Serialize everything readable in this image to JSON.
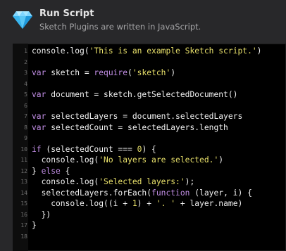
{
  "header": {
    "title": "Run Script",
    "subtitle": "Sketch Plugins are written in JavaScript.",
    "icon": "sketch-diamond-icon"
  },
  "editor": {
    "line_numbers": [
      "1",
      "2",
      "3",
      "4",
      "5",
      "6",
      "7",
      "8",
      "9",
      "10",
      "11",
      "12",
      "13",
      "14",
      "15",
      "16",
      "17",
      "18"
    ],
    "lines": [
      [
        {
          "t": "console.log(",
          "c": "fn"
        },
        {
          "t": "'This is an example Sketch script.'",
          "c": "str"
        },
        {
          "t": ")",
          "c": "fn"
        }
      ],
      [],
      [
        {
          "t": "var",
          "c": "kw"
        },
        {
          "t": " sketch = ",
          "c": "fn"
        },
        {
          "t": "require",
          "c": "kw"
        },
        {
          "t": "(",
          "c": "fn"
        },
        {
          "t": "'sketch'",
          "c": "str"
        },
        {
          "t": ")",
          "c": "fn"
        }
      ],
      [],
      [
        {
          "t": "var",
          "c": "kw"
        },
        {
          "t": " document = sketch.getSelectedDocument()",
          "c": "fn"
        }
      ],
      [],
      [
        {
          "t": "var",
          "c": "kw"
        },
        {
          "t": " selectedLayers = document.selectedLayers",
          "c": "fn"
        }
      ],
      [
        {
          "t": "var",
          "c": "kw"
        },
        {
          "t": " selectedCount = selectedLayers.length",
          "c": "fn"
        }
      ],
      [],
      [
        {
          "t": "if",
          "c": "kw"
        },
        {
          "t": " (selectedCount === ",
          "c": "fn"
        },
        {
          "t": "0",
          "c": "num"
        },
        {
          "t": ") {",
          "c": "fn"
        }
      ],
      [
        {
          "t": "  console.log(",
          "c": "fn"
        },
        {
          "t": "'No layers are selected.'",
          "c": "str"
        },
        {
          "t": ")",
          "c": "fn"
        }
      ],
      [
        {
          "t": "} ",
          "c": "fn"
        },
        {
          "t": "else",
          "c": "kw"
        },
        {
          "t": " {",
          "c": "fn"
        }
      ],
      [
        {
          "t": "  console.log(",
          "c": "fn"
        },
        {
          "t": "'Selected layers:'",
          "c": "str"
        },
        {
          "t": ");",
          "c": "fn"
        }
      ],
      [
        {
          "t": "  selectedLayers.forEach(",
          "c": "fn"
        },
        {
          "t": "function",
          "c": "kw"
        },
        {
          "t": " (layer, i) {",
          "c": "fn"
        }
      ],
      [
        {
          "t": "    console.log((i + ",
          "c": "fn"
        },
        {
          "t": "1",
          "c": "num"
        },
        {
          "t": ") + ",
          "c": "fn"
        },
        {
          "t": "'. '",
          "c": "str"
        },
        {
          "t": " + layer.name)",
          "c": "fn"
        }
      ],
      [
        {
          "t": "  })",
          "c": "fn"
        }
      ],
      [
        {
          "t": "}",
          "c": "fn"
        }
      ],
      []
    ]
  },
  "colors": {
    "background": "#28282a",
    "editor_bg": "#000000",
    "keyword": "#c28ee6",
    "string": "#e8e06a",
    "text": "#f2f2f2",
    "gem_light": "#9fe4ff",
    "gem_dark": "#2aa8e8"
  }
}
